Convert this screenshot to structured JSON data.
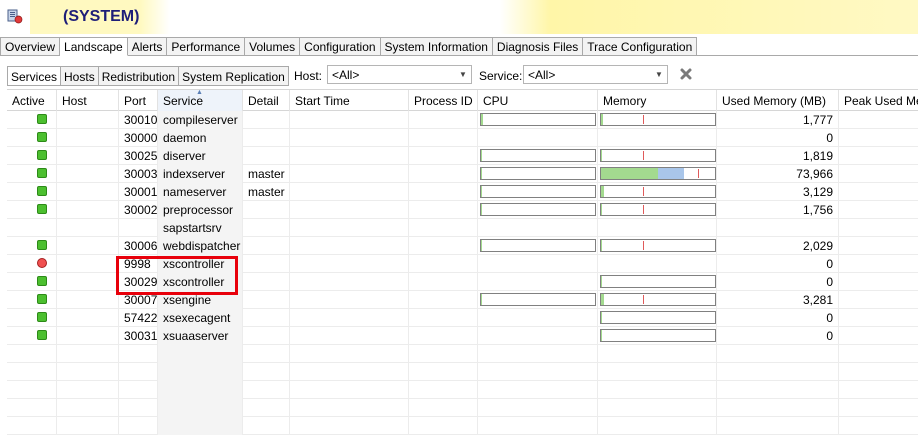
{
  "window": {
    "title": "(SYSTEM)"
  },
  "main_tabs": [
    {
      "label": "Overview",
      "active": false
    },
    {
      "label": "Landscape",
      "active": true
    },
    {
      "label": "Alerts",
      "active": false
    },
    {
      "label": "Performance",
      "active": false
    },
    {
      "label": "Volumes",
      "active": false
    },
    {
      "label": "Configuration",
      "active": false
    },
    {
      "label": "System Information",
      "active": false
    },
    {
      "label": "Diagnosis Files",
      "active": false
    },
    {
      "label": "Trace Configuration",
      "active": false
    }
  ],
  "sub_tabs": [
    {
      "label": "Services",
      "active": true
    },
    {
      "label": "Hosts",
      "active": false
    },
    {
      "label": "Redistribution",
      "active": false
    },
    {
      "label": "System Replication",
      "active": false
    }
  ],
  "filters": {
    "host_label": "Host:",
    "host_value": "<All>",
    "service_label": "Service:",
    "service_value": "<All>"
  },
  "columns": [
    "Active",
    "Host",
    "Port",
    "Service",
    "Detail",
    "Start Time",
    "Process ID",
    "CPU",
    "Memory",
    "Used Memory (MB)",
    "Peak Used Me"
  ],
  "colors": {
    "active_green": "#4cbf2f",
    "inactive_red": "#f05050",
    "highlight": "#e8000b"
  },
  "rows": [
    {
      "status": "green",
      "port": "30010",
      "service": "compileserver",
      "detail": "",
      "cpu": 0.02,
      "mem_used": 0.02,
      "mem_mark": 0.37,
      "used_memory": "1,777",
      "has_cpu": true,
      "has_mem": true
    },
    {
      "status": "green",
      "port": "30000",
      "service": "daemon",
      "detail": "",
      "has_cpu": false,
      "has_mem": false,
      "used_memory": "0"
    },
    {
      "status": "green",
      "port": "30025",
      "service": "diserver",
      "detail": "",
      "cpu": 0.01,
      "mem_used": 0.01,
      "mem_mark": 0.37,
      "used_memory": "1,819",
      "has_cpu": true,
      "has_mem": true
    },
    {
      "status": "green",
      "port": "30003",
      "service": "indexserver",
      "detail": "master",
      "cpu": 0.01,
      "mem_used": 0.5,
      "mem_blue": 0.23,
      "mem_mark": 0.85,
      "used_memory": "73,966",
      "has_cpu": true,
      "has_mem": true
    },
    {
      "status": "green",
      "port": "30001",
      "service": "nameserver",
      "detail": "master",
      "cpu": 0.01,
      "mem_used": 0.03,
      "mem_mark": 0.37,
      "used_memory": "3,129",
      "has_cpu": true,
      "has_mem": true
    },
    {
      "status": "green",
      "port": "30002",
      "service": "preprocessor",
      "detail": "",
      "cpu": 0.01,
      "mem_used": 0.01,
      "mem_mark": 0.37,
      "used_memory": "1,756",
      "has_cpu": true,
      "has_mem": true
    },
    {
      "status": "none",
      "port": "",
      "service": "sapstartsrv",
      "detail": "",
      "has_cpu": false,
      "has_mem": false,
      "used_memory": ""
    },
    {
      "status": "green",
      "port": "30006",
      "service": "webdispatcher",
      "detail": "",
      "cpu": 0.01,
      "mem_used": 0.01,
      "mem_mark": 0.37,
      "used_memory": "2,029",
      "has_cpu": true,
      "has_mem": true
    },
    {
      "status": "red",
      "port": "9998",
      "service": "xscontroller",
      "detail": "",
      "has_cpu": false,
      "has_mem": false,
      "used_memory": "0"
    },
    {
      "status": "green",
      "port": "30029",
      "service": "xscontroller",
      "detail": "",
      "has_cpu": false,
      "has_mem": true,
      "mem_used": 0.005,
      "used_memory": "0"
    },
    {
      "status": "green",
      "port": "30007",
      "service": "xsengine",
      "detail": "",
      "cpu": 0.01,
      "mem_used": 0.03,
      "mem_mark": 0.37,
      "used_memory": "3,281",
      "has_cpu": true,
      "has_mem": true
    },
    {
      "status": "green",
      "port": "57422",
      "service": "xsexecagent",
      "detail": "",
      "has_cpu": false,
      "has_mem": true,
      "mem_used": 0.005,
      "used_memory": "0"
    },
    {
      "status": "green",
      "port": "30031",
      "service": "xsuaaserver",
      "detail": "",
      "has_cpu": false,
      "has_mem": true,
      "mem_used": 0.005,
      "used_memory": "0"
    }
  ]
}
